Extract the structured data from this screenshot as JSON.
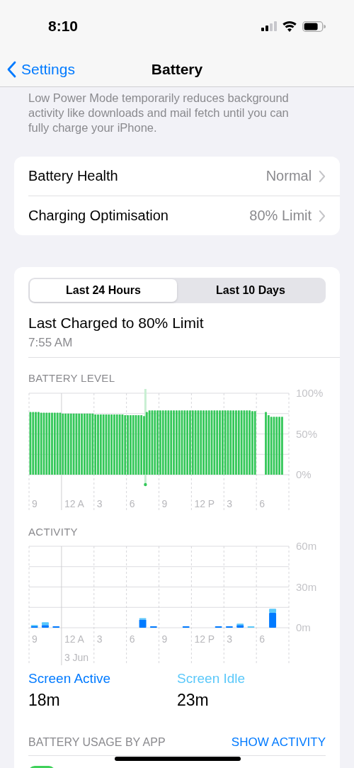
{
  "status_bar": {
    "time": "8:10"
  },
  "nav": {
    "back": "Settings",
    "title": "Battery"
  },
  "low_power_footer": "Low Power Mode temporarily reduces background activity like downloads and mail fetch until you can fully charge your iPhone.",
  "health_rows": [
    {
      "label": "Battery Health",
      "value": "Normal"
    },
    {
      "label": "Charging Optimisation",
      "value": "80% Limit"
    }
  ],
  "usage": {
    "tabs": [
      {
        "label": "Last 24 Hours",
        "selected": true
      },
      {
        "label": "Last 10 Days",
        "selected": false
      }
    ],
    "last_charged": {
      "title": "Last Charged to 80% Limit",
      "time": "7:55 AM"
    },
    "battery_level": {
      "chart_data": {
        "type": "bar",
        "title": "BATTERY LEVEL",
        "ylim": [
          0,
          100
        ],
        "yticks": [
          {
            "value": 0,
            "label": "0%"
          },
          {
            "value": 50,
            "label": "50%"
          },
          {
            "value": 100,
            "label": "100%"
          }
        ],
        "categories": [
          null,
          "9",
          null,
          null,
          null,
          null,
          null,
          null,
          null,
          null,
          null,
          null,
          null,
          null,
          null,
          null,
          "12 A",
          null,
          null,
          null,
          null,
          null,
          null,
          null,
          null,
          "3",
          null,
          null,
          null,
          null,
          null,
          null,
          null,
          null,
          null,
          null,
          null,
          "6",
          null,
          null,
          null,
          null,
          null,
          null,
          null,
          null,
          null,
          null,
          null,
          "9",
          null,
          null,
          null,
          null,
          null,
          null,
          null,
          null,
          null,
          null,
          null,
          null,
          null,
          null,
          "12 P",
          null,
          null,
          null,
          null,
          null,
          null,
          null,
          null,
          "3",
          null,
          null,
          null,
          null,
          null,
          null,
          null,
          null,
          null,
          null,
          null,
          "6",
          null,
          null,
          null,
          null,
          null,
          null,
          null,
          null,
          null,
          null
        ],
        "values": [
          77,
          77,
          77,
          77,
          76,
          76,
          76,
          76,
          76,
          76,
          76,
          76,
          75,
          75,
          75,
          75,
          75,
          75,
          75,
          75,
          75,
          75,
          75,
          75,
          74,
          74,
          74,
          74,
          74,
          74,
          74,
          74,
          74,
          74,
          74,
          73,
          73,
          73,
          73,
          73,
          73,
          73,
          72,
          77,
          79,
          79,
          79,
          79,
          79,
          79,
          79,
          79,
          79,
          79,
          79,
          79,
          79,
          79,
          79,
          79,
          79,
          79,
          79,
          79,
          79,
          79,
          79,
          79,
          79,
          79,
          79,
          79,
          79,
          79,
          79,
          79,
          79,
          79,
          79,
          79,
          79,
          79,
          78,
          78,
          null,
          null,
          null,
          77,
          73,
          71,
          71,
          71,
          71,
          71,
          null,
          null
        ],
        "color": "#34c759"
      }
    },
    "activity": {
      "chart_data": {
        "type": "bar",
        "title": "ACTIVITY",
        "stacked": true,
        "ylim": [
          0,
          60
        ],
        "yticks": [
          {
            "value": 0,
            "label": "0m"
          },
          {
            "value": 30,
            "label": "30m"
          },
          {
            "value": 60,
            "label": "60m"
          }
        ],
        "categories": [
          "9",
          null,
          null,
          null,
          "12 A",
          null,
          "3",
          null,
          null,
          "6",
          null,
          null,
          "9",
          null,
          null,
          null,
          "12 P",
          null,
          "3",
          null,
          null,
          "6",
          null,
          null
        ],
        "series": [
          {
            "name": "Screen Active",
            "color": "#007aff",
            "values": [
              1,
              2,
              1,
              0,
              0,
              0,
              0,
              0,
              0,
              0,
              6,
              1,
              0,
              0,
              1,
              0,
              0,
              1,
              1,
              2,
              0,
              0,
              11,
              0
            ]
          },
          {
            "name": "Screen Idle",
            "color": "#5ac8fa",
            "values": [
              1,
              2,
              0,
              0,
              0,
              0,
              0,
              0,
              0,
              0,
              1,
              0,
              0,
              0,
              0,
              0,
              0,
              0,
              0,
              1,
              1,
              0,
              3,
              0
            ]
          }
        ],
        "annotations": [
          "3 Jun"
        ]
      },
      "totals": [
        "18m",
        "23m"
      ]
    },
    "app_usage": {
      "header": "BATTERY USAGE BY APP",
      "action": "SHOW ACTIVITY"
    }
  }
}
